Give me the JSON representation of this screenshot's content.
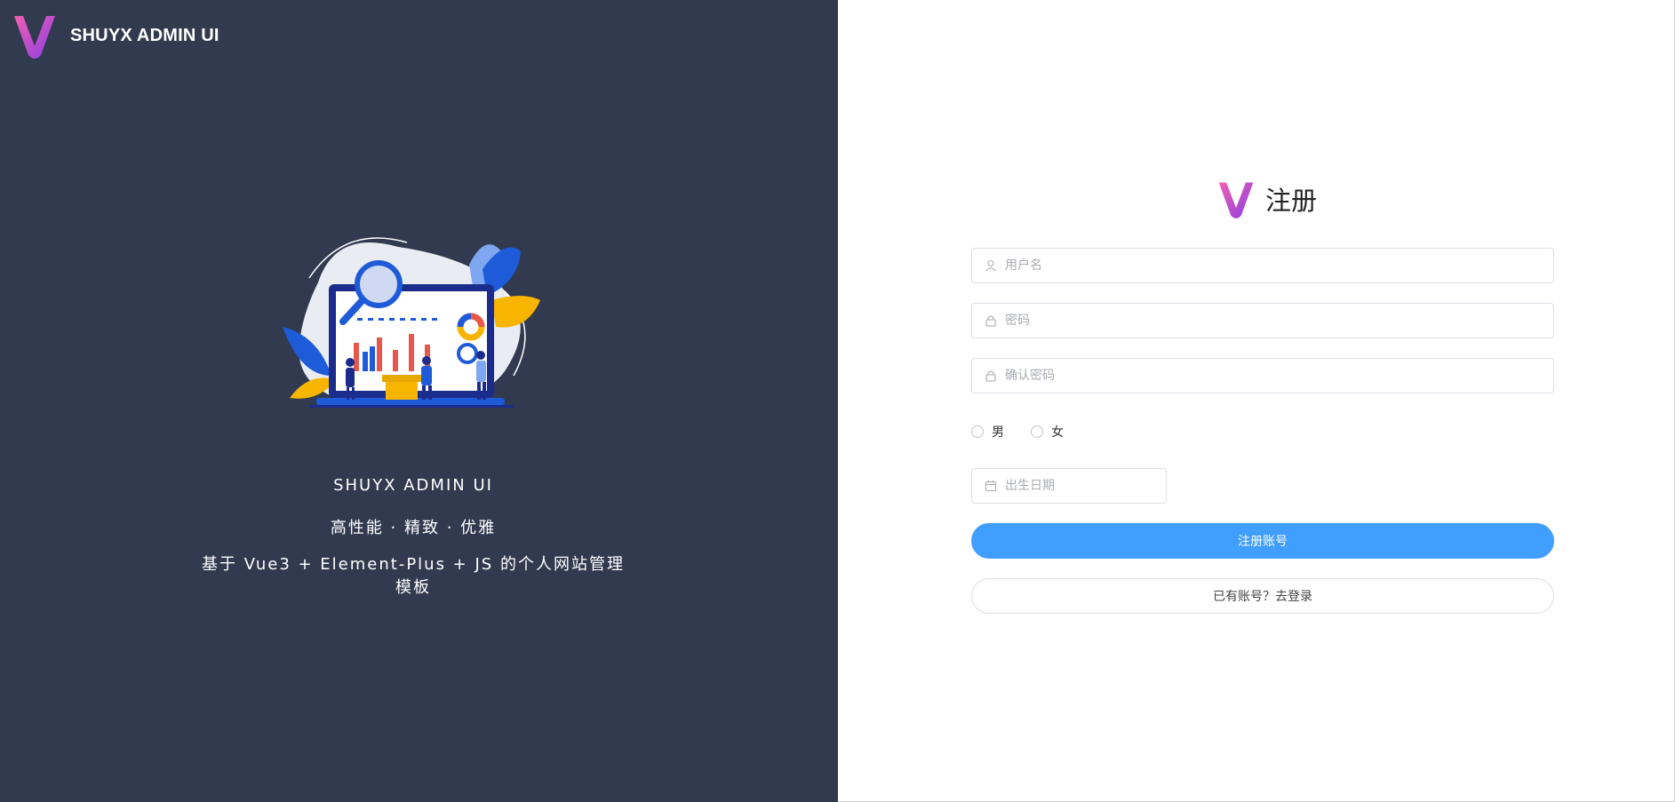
{
  "brand": {
    "name": "SHUYX ADMIN UI",
    "logo_icon": "v-logo-icon"
  },
  "left": {
    "illustration": "dashboard-analytics-illustration",
    "slogan_title": "SHUYX ADMIN UI",
    "slogan_features": "高性能 · 精致 · 优雅",
    "slogan_desc": "基于 Vue3 + Element-Plus + JS 的个人网站管理模板"
  },
  "form": {
    "title": "注册",
    "username": {
      "value": "",
      "placeholder": "用户名",
      "icon": "user-icon"
    },
    "password": {
      "value": "",
      "placeholder": "密码",
      "icon": "lock-icon"
    },
    "confirm_password": {
      "value": "",
      "placeholder": "确认密码",
      "icon": "lock-icon"
    },
    "gender": {
      "options": [
        "男",
        "女"
      ],
      "selected": ""
    },
    "birthday": {
      "value": "",
      "placeholder": "出生日期",
      "icon": "calendar-icon"
    },
    "register_label": "注册账号",
    "login_label": "已有账号？去登录"
  },
  "colors": {
    "left_bg": "#313a4f",
    "primary": "#409eff",
    "logo_gradient_start": "#e84fb1",
    "logo_gradient_end": "#8a3fe0"
  }
}
